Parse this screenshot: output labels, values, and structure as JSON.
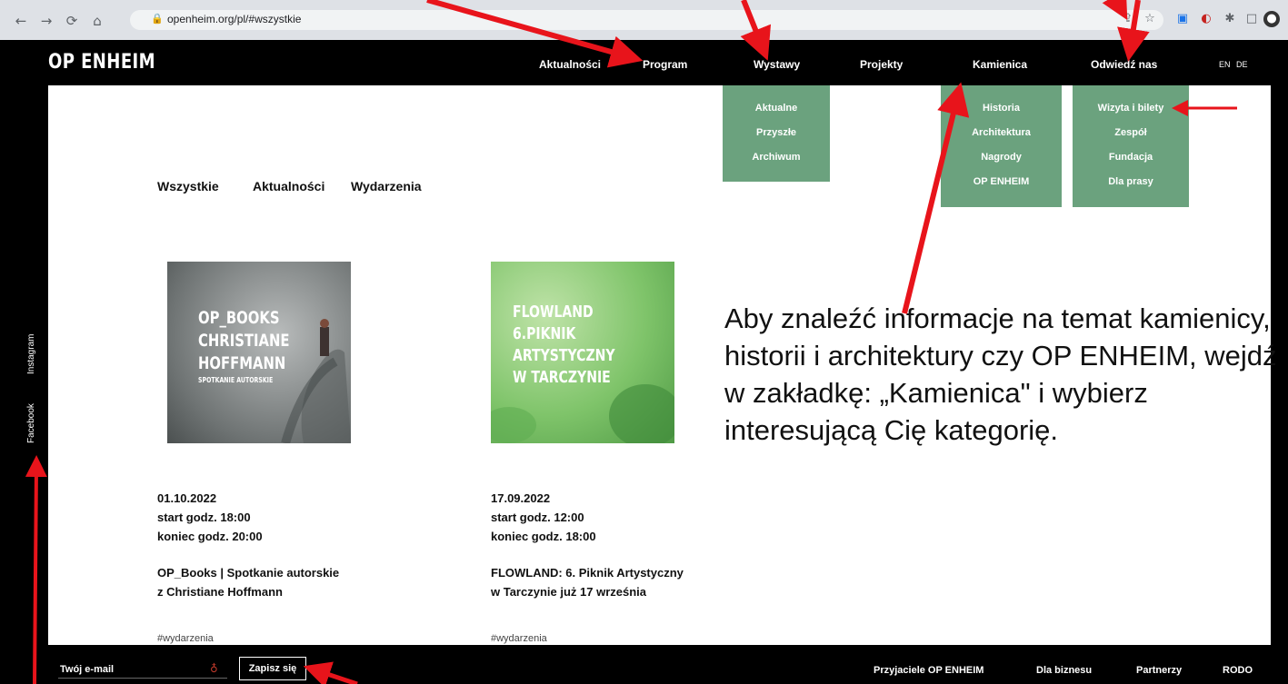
{
  "browser": {
    "url": "openheim.org/pl/#wszystkie"
  },
  "site": {
    "logo": "OP ENHEIM",
    "nav": [
      "Aktualności",
      "Program",
      "Wystawy",
      "Projekty",
      "Kamienica",
      "Odwiedź nas"
    ],
    "lang": [
      "EN",
      "DE"
    ]
  },
  "dropdowns": {
    "wystawy": [
      "Aktualne",
      "Przyszłe",
      "Archiwum"
    ],
    "kamienica": [
      "Historia",
      "Architektura",
      "Nagrody",
      "OP ENHEIM"
    ],
    "odwiedz": [
      "Wizyta i bilety",
      "Zespół",
      "Fundacja",
      "Dla prasy"
    ]
  },
  "filters": [
    "Wszystkie",
    "Aktualności",
    "Wydarzenia"
  ],
  "cards": [
    {
      "image_text": [
        "OP_BOOKS",
        "CHRISTIANE",
        "HOFFMANN"
      ],
      "image_subtext": "SPOTKANIE AUTORSKIE",
      "date": "01.10.2022",
      "start": "start godz. 18:00",
      "end": "koniec godz. 20:00",
      "title": "OP_Books | Spotkanie autorskie z Christiane Hoffmann",
      "tag": "#wydarzenia"
    },
    {
      "image_text": [
        "FLOWLAND",
        "6.PIKNIK",
        "ARTYSTYCZNY",
        "W TARCZYNIE"
      ],
      "date": "17.09.2022",
      "start": "start godz. 12:00",
      "end": "koniec godz. 18:00",
      "title": "FLOWLAND: 6. Piknik Artystyczny w Tarczynie już 17 września",
      "tag": "#wydarzenia"
    }
  ],
  "instruction": "Aby znaleźć informacje na temat kamienicy, historii i architektury czy OP ENHEIM, wejdź w zakładkę: „Kamienica\" i wybierz interesującą Cię kategorię.",
  "social": [
    "Instagram",
    "Facebook"
  ],
  "footer": {
    "email_placeholder": "Twój e-mail",
    "subscribe": "Zapisz się",
    "links": [
      "Przyjaciele OP ENHEIM",
      "Dla biznesu",
      "Partnerzy",
      "RODO"
    ]
  },
  "colors": {
    "accent_green": "#6ba27e",
    "annotation_red": "#e8141b"
  }
}
